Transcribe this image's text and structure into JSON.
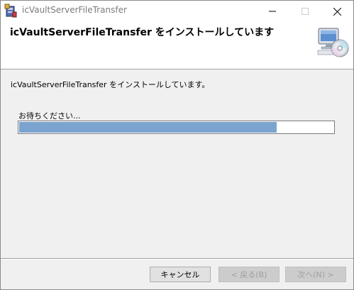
{
  "window": {
    "title": "icVaultServerFileTransfer",
    "icon": "installer-package-icon",
    "caption_buttons": [
      "minimize",
      "maximize",
      "close"
    ]
  },
  "banner": {
    "title": "icVaultServerFileTransfer をインストールしています",
    "icon": "computer-cd-icon"
  },
  "body": {
    "status_text": "icVaultServerFileTransfer をインストールしています。",
    "wait_label": "お待ちください...",
    "progress": {
      "fraction": 0.82,
      "color": "#7aa3cf"
    }
  },
  "footer": {
    "cancel_label": "キャンセル",
    "back_label": "< 戻る(B)",
    "next_label": "次へ(N) >"
  }
}
